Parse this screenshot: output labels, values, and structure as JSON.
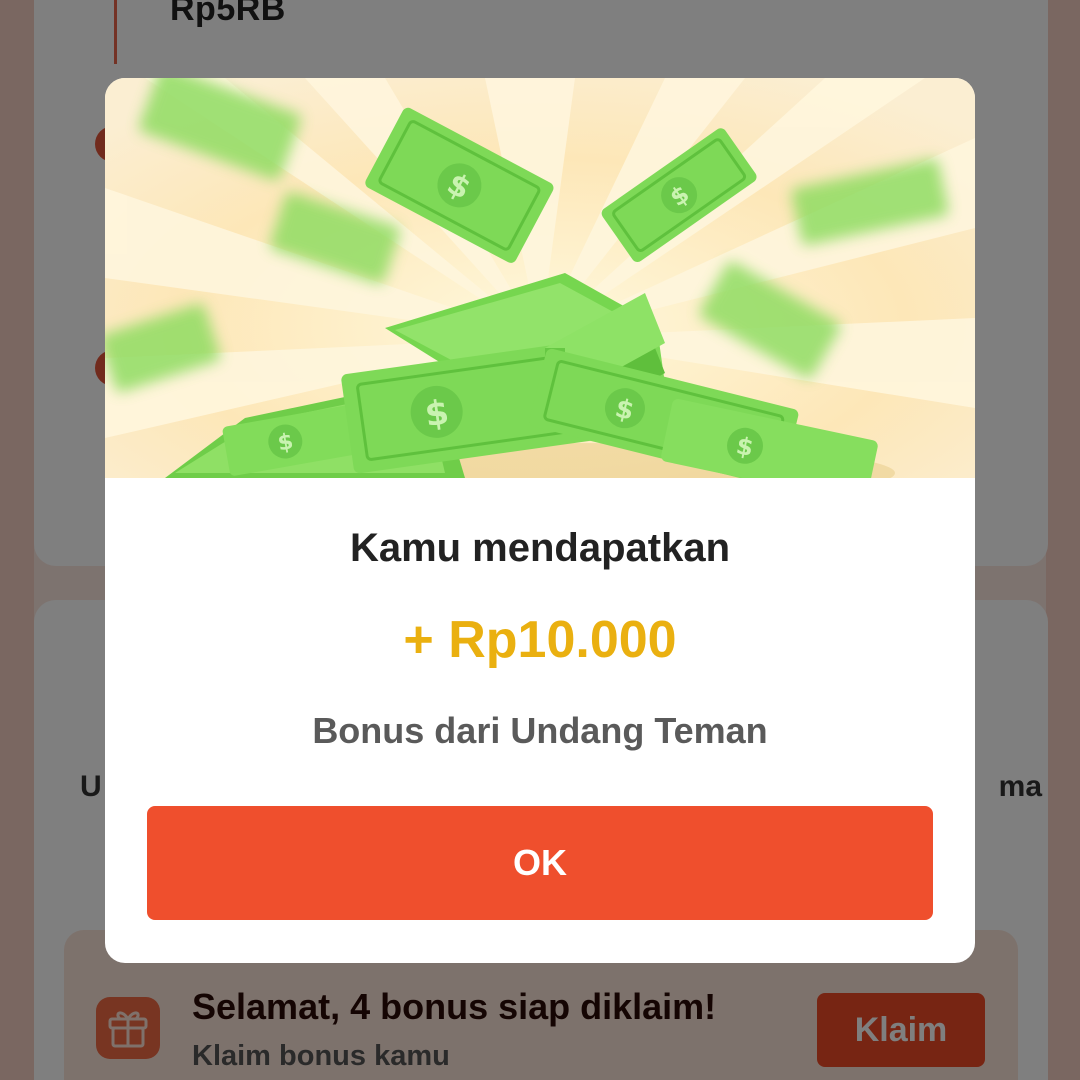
{
  "background": {
    "previous_amount": "Rp5RB",
    "mid_left_fragment": "U",
    "mid_right_fragment": "ma",
    "bonus_banner": {
      "title": "Selamat, 4 bonus siap diklaim!",
      "subtitle": "Klaim bonus kamu",
      "button_label": "Klaim",
      "icon": "gift-icon"
    }
  },
  "modal": {
    "illustration": "money-pile-illustration",
    "title": "Kamu mendapatkan",
    "amount": "+ Rp10.000",
    "subtitle": "Bonus dari Undang Teman",
    "button_label": "OK"
  },
  "colors": {
    "accent": "#ef4f2d",
    "amount": "#eab010",
    "money_green": "#7ed957"
  }
}
